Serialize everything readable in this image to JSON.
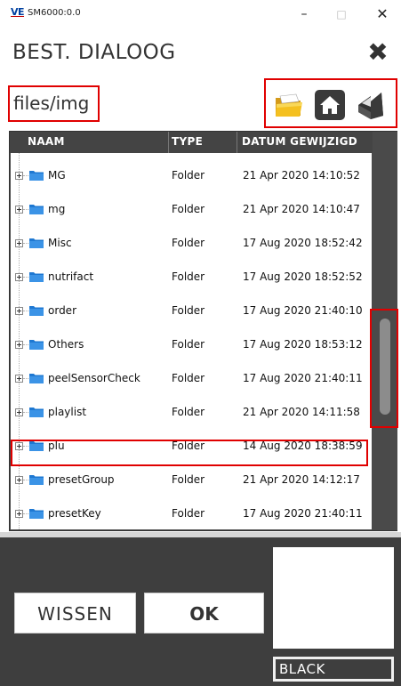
{
  "window": {
    "logo_text": "VE",
    "title": "SM6000:0.0",
    "minimize": "–",
    "maximize": "□",
    "close": "✕"
  },
  "dialog": {
    "title": "BEST. DIALOOG",
    "close": "✖",
    "path": "files/img"
  },
  "toolbar": {
    "icons": [
      "open-folder-icon",
      "home-icon",
      "folder-up-icon"
    ]
  },
  "table": {
    "headers": {
      "name": "NAAM",
      "type": "TYPE",
      "date": "DATUM GEWIJZIGD"
    },
    "rows": [
      {
        "name": "MG",
        "type": "Folder",
        "date": "21 Apr 2020 14:10:52"
      },
      {
        "name": "mg",
        "type": "Folder",
        "date": "21 Apr 2020 14:10:47"
      },
      {
        "name": "Misc",
        "type": "Folder",
        "date": "17 Aug 2020 18:52:42"
      },
      {
        "name": "nutrifact",
        "type": "Folder",
        "date": "17 Aug 2020 18:52:52"
      },
      {
        "name": "order",
        "type": "Folder",
        "date": "17 Aug 2020 21:40:10"
      },
      {
        "name": "Others",
        "type": "Folder",
        "date": "17 Aug 2020 18:53:12"
      },
      {
        "name": "peelSensorCheck",
        "type": "Folder",
        "date": "17 Aug 2020 21:40:11"
      },
      {
        "name": "playlist",
        "type": "Folder",
        "date": "21 Apr 2020 14:11:58"
      },
      {
        "name": "plu",
        "type": "Folder",
        "date": "14 Aug 2020 18:38:59"
      },
      {
        "name": "presetGroup",
        "type": "Folder",
        "date": "21 Apr 2020 14:12:17"
      },
      {
        "name": "presetKey",
        "type": "Folder",
        "date": "17 Aug 2020 21:40:11"
      }
    ]
  },
  "buttons": {
    "clear": "WISSEN",
    "ok": "OK",
    "color": "BLACK"
  },
  "colors": {
    "highlight": "#e00000",
    "panel": "#4a4a4a",
    "bottom": "#3e3e3e",
    "folder": "#1e78d2"
  }
}
